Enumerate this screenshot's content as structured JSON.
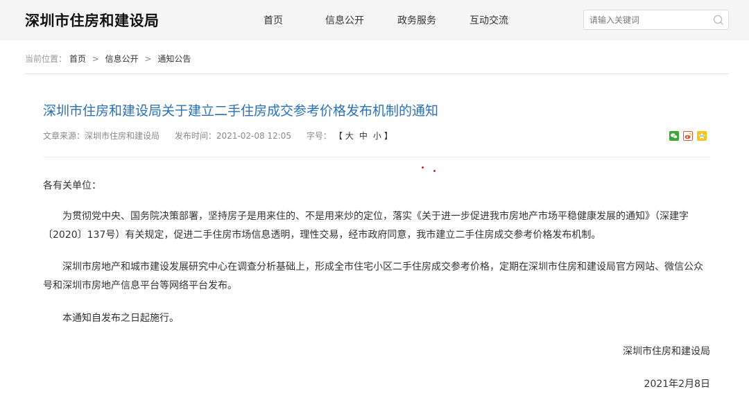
{
  "header": {
    "site_title": "深圳市住房和建设局",
    "nav": [
      "首页",
      "信息公开",
      "政务服务",
      "互动交流"
    ],
    "search_placeholder": "请输入关键词"
  },
  "breadcrumb": {
    "label": "当前位置：",
    "items": [
      "首页",
      "信息公开",
      "通知公告"
    ],
    "separator": ">"
  },
  "article": {
    "title": "深圳市住房和建设局关于建立二手住房成交参考价格发布机制的通知",
    "source_label": "文章来源：",
    "source": "深圳市住房和建设局",
    "time_label": "发布时间：",
    "time": "2021-02-08 12:05",
    "fontsize_label": "字号：",
    "fontsize_open": "【",
    "fontsize_options": [
      "大",
      "中",
      "小"
    ],
    "fontsize_close": "】",
    "salutation": "各有关单位：",
    "paragraphs": [
      "为贯彻党中央、国务院决策部署，坚持房子是用来住的、不是用来炒的定位，落实《关于进一步促进我市房地产市场平稳健康发展的通知》（深建字〔2020〕137号）有关规定，促进二手住房市场信息透明，理性交易，经市政府同意，我市建立二手住房成交参考价格发布机制。",
      "深圳市房地产和城市建设发展研究中心在调查分析基础上，形成全市住宅小区二手住房成交参考价格，定期在深圳市住房和建设局官方网站、微信公众号和深圳市房地产信息平台等网络平台发布。",
      "本通知自发布之日起施行。"
    ],
    "signature_org": "深圳市住房和建设局",
    "signature_date": "2021年2月8日"
  },
  "share": {
    "icons": [
      "wechat-icon",
      "weibo-icon",
      "qzone-icon"
    ]
  },
  "colors": {
    "title_blue": "#2a70b8",
    "header_bg": "#f5f5f5"
  }
}
